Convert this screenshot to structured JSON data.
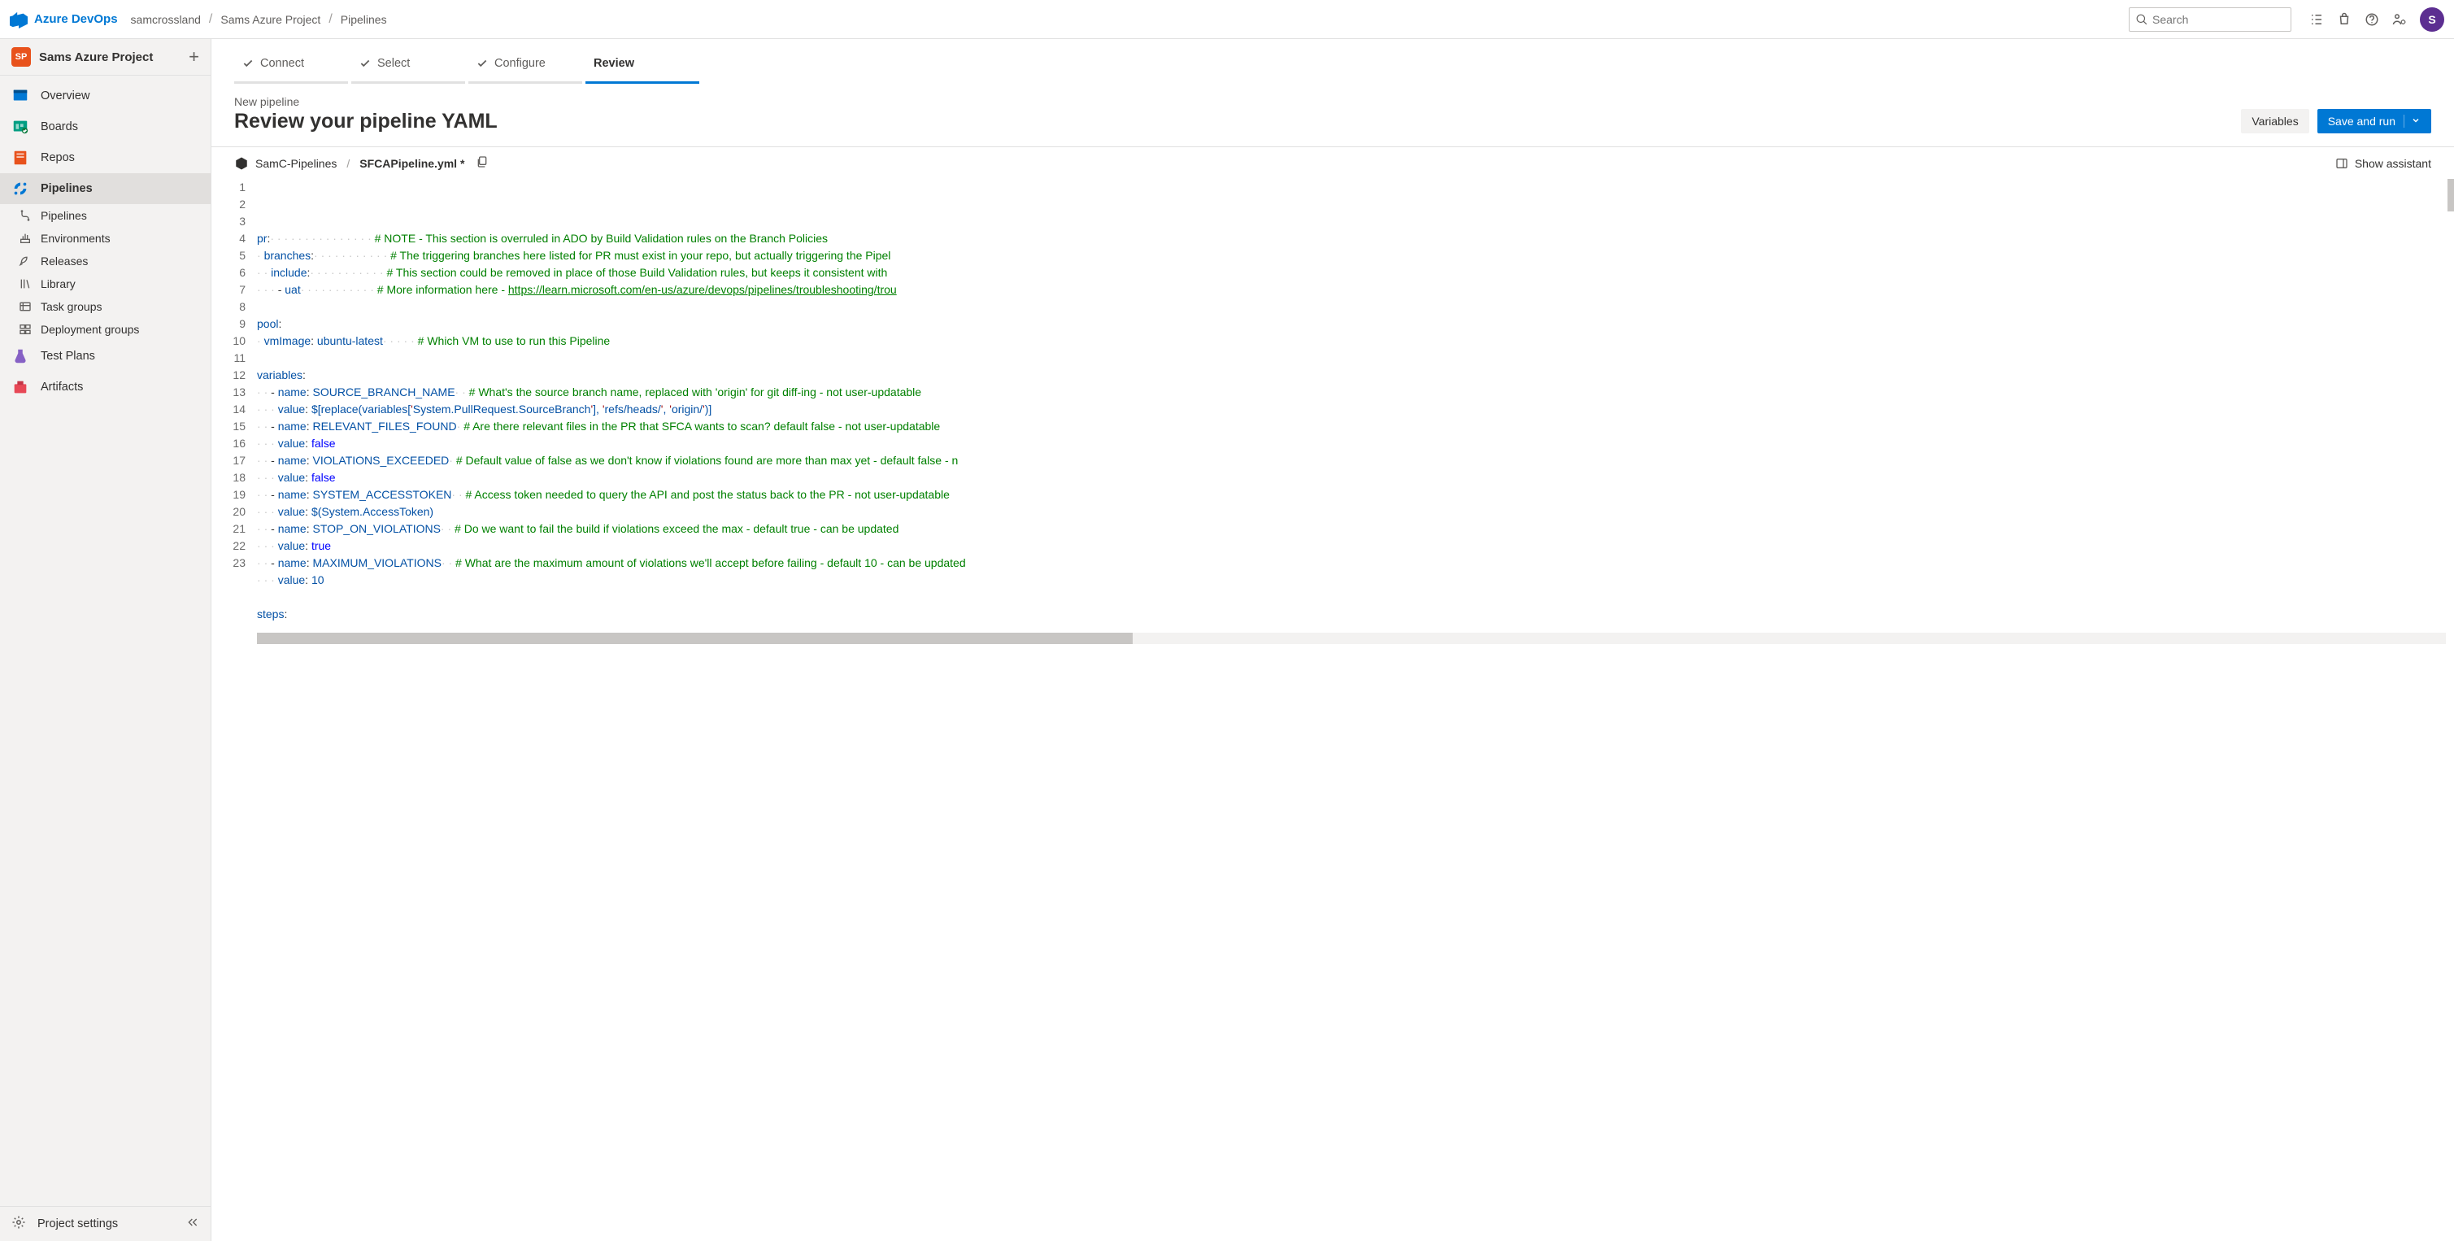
{
  "topbar": {
    "brand": "Azure DevOps",
    "crumbs": [
      "samcrossland",
      "Sams Azure Project",
      "Pipelines"
    ],
    "search_placeholder": "Search",
    "avatar_letter": "S"
  },
  "sidebar": {
    "project_badge": "SP",
    "project_name": "Sams Azure Project",
    "items": [
      {
        "label": "Overview",
        "icon": "overview"
      },
      {
        "label": "Boards",
        "icon": "boards"
      },
      {
        "label": "Repos",
        "icon": "repos"
      },
      {
        "label": "Pipelines",
        "icon": "pipelines",
        "selected": true,
        "subs": [
          {
            "label": "Pipelines",
            "icon": "pipeline-sub"
          },
          {
            "label": "Environments",
            "icon": "environments"
          },
          {
            "label": "Releases",
            "icon": "releases"
          },
          {
            "label": "Library",
            "icon": "library"
          },
          {
            "label": "Task groups",
            "icon": "task-groups"
          },
          {
            "label": "Deployment groups",
            "icon": "deployment-groups"
          }
        ]
      },
      {
        "label": "Test Plans",
        "icon": "test-plans"
      },
      {
        "label": "Artifacts",
        "icon": "artifacts"
      }
    ],
    "footer_label": "Project settings"
  },
  "wizard": {
    "steps": [
      "Connect",
      "Select",
      "Configure",
      "Review"
    ],
    "active_index": 3,
    "subtitle": "New pipeline",
    "title": "Review your pipeline YAML",
    "variables_btn": "Variables",
    "save_btn": "Save and run"
  },
  "editor": {
    "repo": "SamC-Pipelines",
    "file": "SFCAPipeline.yml *",
    "assistant_label": "Show assistant",
    "lines": [
      {
        "n": 1,
        "indent": 0,
        "type": "key",
        "key": "pr",
        "comment": "# NOTE - This section is overruled in ADO by Build Validation rules on the Branch Policies"
      },
      {
        "n": 2,
        "indent": 1,
        "type": "key",
        "key": "branches",
        "comment": "# The triggering branches here listed for PR must exist in your repo, but actually triggering the Pipel"
      },
      {
        "n": 3,
        "indent": 2,
        "type": "key",
        "key": "include",
        "comment": "# This section could be removed in place of those Build Validation rules, but keeps it consistent with "
      },
      {
        "n": 4,
        "indent": 3,
        "type": "item",
        "value": "uat",
        "comment": "# More information here - ",
        "link": "https://learn.microsoft.com/en-us/azure/devops/pipelines/troubleshooting/trou"
      },
      {
        "n": 5,
        "indent": 0,
        "type": "blank"
      },
      {
        "n": 6,
        "indent": 0,
        "type": "key",
        "key": "pool"
      },
      {
        "n": 7,
        "indent": 1,
        "type": "kv",
        "key": "vmImage",
        "value": "ubuntu-latest",
        "comment": "# Which VM to use to run this Pipeline"
      },
      {
        "n": 8,
        "indent": 0,
        "type": "blank"
      },
      {
        "n": 9,
        "indent": 0,
        "type": "key",
        "key": "variables"
      },
      {
        "n": 10,
        "indent": 2,
        "type": "itemkv",
        "key": "name",
        "value": "SOURCE_BRANCH_NAME",
        "comment": "# What's the source branch name, replaced with 'origin' for git diff-ing - not user-updatable"
      },
      {
        "n": 11,
        "indent": 3,
        "type": "kv",
        "key": "value",
        "raw": "$[replace(variables['System.PullRequest.SourceBranch'], 'refs/heads/', 'origin/')]"
      },
      {
        "n": 12,
        "indent": 2,
        "type": "itemkv",
        "key": "name",
        "value": "RELEVANT_FILES_FOUND",
        "comment": "# Are there relevant files in the PR that SFCA wants to scan? default false - not user-updatable"
      },
      {
        "n": 13,
        "indent": 3,
        "type": "kv",
        "key": "value",
        "bool": "false"
      },
      {
        "n": 14,
        "indent": 2,
        "type": "itemkv",
        "key": "name",
        "value": "VIOLATIONS_EXCEEDED",
        "comment": "# Default value of false as we don't know if violations found are more than max yet - default false - n"
      },
      {
        "n": 15,
        "indent": 3,
        "type": "kv",
        "key": "value",
        "bool": "false"
      },
      {
        "n": 16,
        "indent": 2,
        "type": "itemkv",
        "key": "name",
        "value": "SYSTEM_ACCESSTOKEN",
        "comment": "# Access token needed to query the API and post the status back to the PR - not user-updatable"
      },
      {
        "n": 17,
        "indent": 3,
        "type": "kv",
        "key": "value",
        "raw": "$(System.AccessToken)"
      },
      {
        "n": 18,
        "indent": 2,
        "type": "itemkv",
        "key": "name",
        "value": "STOP_ON_VIOLATIONS",
        "comment": "# Do we want to fail the build if violations exceed the max - default true - can be updated"
      },
      {
        "n": 19,
        "indent": 3,
        "type": "kv",
        "key": "value",
        "bool": "true"
      },
      {
        "n": 20,
        "indent": 2,
        "type": "itemkv",
        "key": "name",
        "value": "MAXIMUM_VIOLATIONS",
        "comment": "# What are the maximum amount of violations we'll accept before failing - default 10 - can be updated"
      },
      {
        "n": 21,
        "indent": 3,
        "type": "kv",
        "key": "value",
        "num": "10"
      },
      {
        "n": 22,
        "indent": 0,
        "type": "blank"
      },
      {
        "n": 23,
        "indent": 0,
        "type": "key",
        "key": "steps"
      }
    ]
  }
}
